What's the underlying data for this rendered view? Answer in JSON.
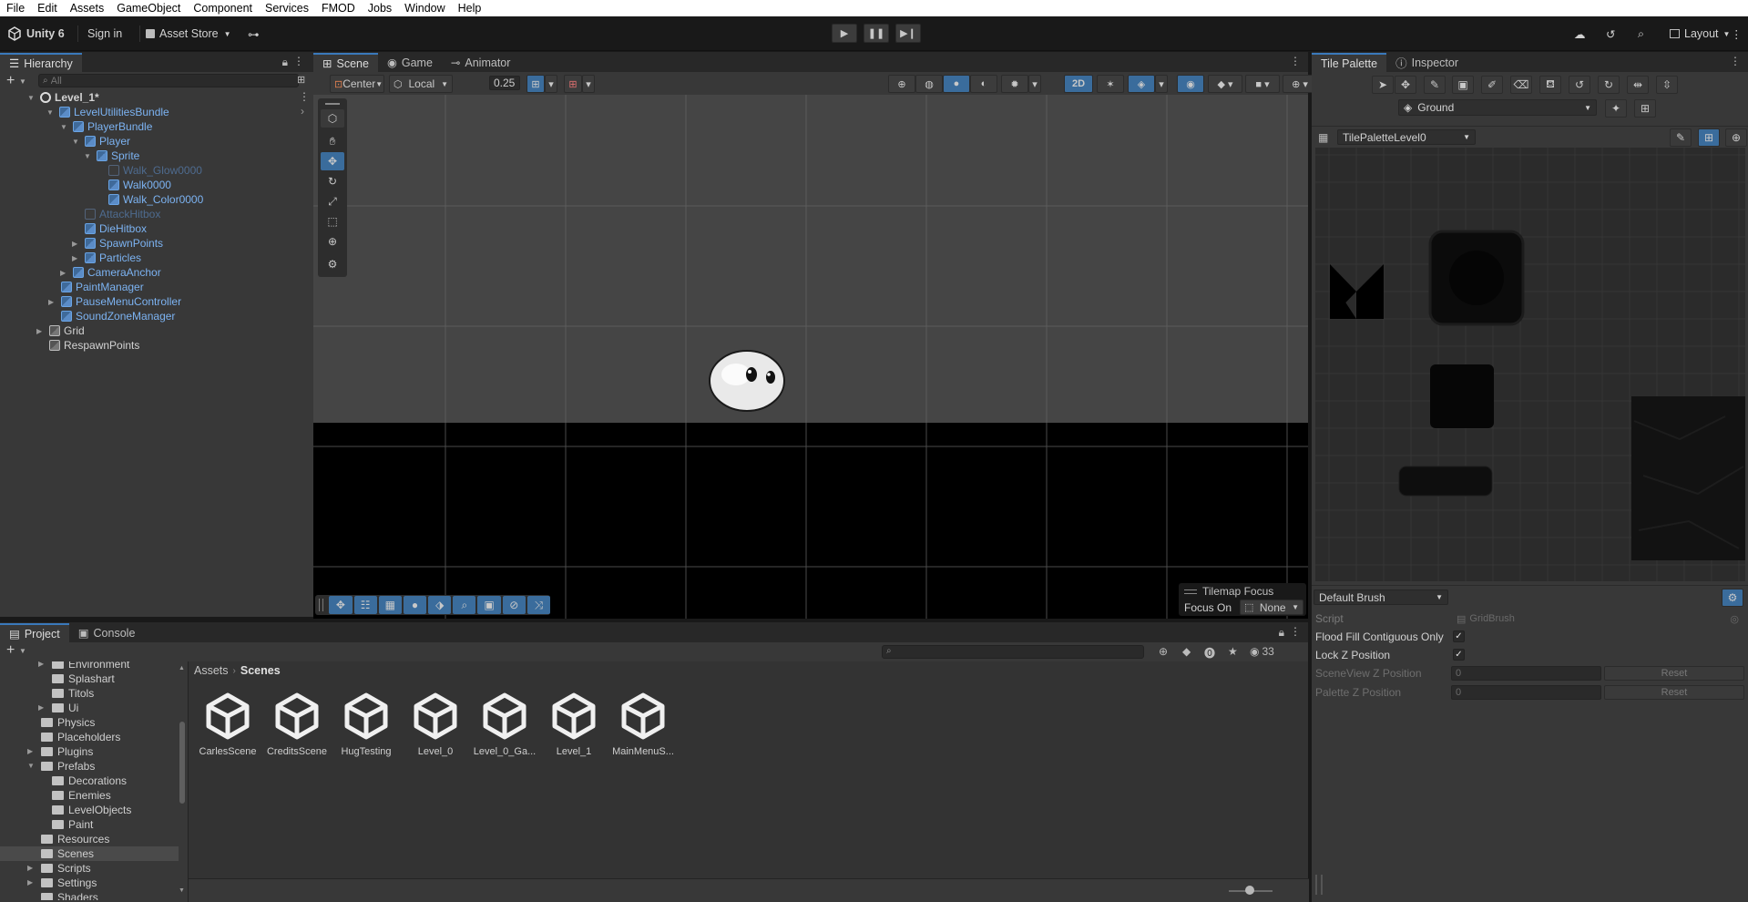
{
  "menu": [
    "File",
    "Edit",
    "Assets",
    "GameObject",
    "Component",
    "Services",
    "FMOD",
    "Jobs",
    "Window",
    "Help"
  ],
  "toolbar": {
    "account": "Unity 6",
    "sign_in": "Sign in",
    "asset_store": "Asset Store",
    "layout": "Layout"
  },
  "hierarchy": {
    "tab": "Hierarchy",
    "search_placeholder": "All",
    "scene": "Level_1*",
    "items": [
      {
        "label": "LevelUtilitiesBundle",
        "depth": 1,
        "style": "blue",
        "expand": "open",
        "icon": "prefab"
      },
      {
        "label": "PlayerBundle",
        "depth": 2,
        "style": "blue",
        "expand": "open",
        "icon": "prefab"
      },
      {
        "label": "Player",
        "depth": 3,
        "style": "blue",
        "expand": "open",
        "icon": "prefab"
      },
      {
        "label": "Sprite",
        "depth": 4,
        "style": "blue",
        "expand": "open",
        "icon": "prefab"
      },
      {
        "label": "Walk_Glow0000",
        "depth": 5,
        "style": "faded",
        "expand": "none",
        "icon": "prefab"
      },
      {
        "label": "Walk0000",
        "depth": 5,
        "style": "blue",
        "expand": "none",
        "icon": "prefab"
      },
      {
        "label": "Walk_Color0000",
        "depth": 5,
        "style": "blue",
        "expand": "none",
        "icon": "prefab"
      },
      {
        "label": "AttackHitbox",
        "depth": 3,
        "style": "faded",
        "expand": "none",
        "icon": "prefab"
      },
      {
        "label": "DieHitbox",
        "depth": 3,
        "style": "blue",
        "expand": "none",
        "icon": "prefab"
      },
      {
        "label": "SpawnPoints",
        "depth": 3,
        "style": "blue",
        "expand": "closed",
        "icon": "prefab"
      },
      {
        "label": "Particles",
        "depth": 3,
        "style": "blue",
        "expand": "closed",
        "icon": "prefab"
      },
      {
        "label": "CameraAnchor",
        "depth": 2,
        "style": "blue",
        "expand": "closed",
        "icon": "prefab"
      },
      {
        "label": "PaintManager",
        "depth": 1,
        "style": "blue",
        "expand": "none",
        "icon": "prefab"
      },
      {
        "label": "PauseMenuController",
        "depth": 1,
        "style": "blue",
        "expand": "closed",
        "icon": "prefab"
      },
      {
        "label": "SoundZoneManager",
        "depth": 1,
        "style": "blue",
        "expand": "none",
        "icon": "prefab"
      },
      {
        "label": "Grid",
        "depth": 0,
        "style": "white",
        "expand": "closed",
        "icon": "object"
      },
      {
        "label": "RespawnPoints",
        "depth": 0,
        "style": "white",
        "expand": "none",
        "icon": "object"
      }
    ]
  },
  "scene_tabs": {
    "scene": "Scene",
    "game": "Game",
    "animator": "Animator"
  },
  "scene_toolbar": {
    "pivot": "Center",
    "space": "Local",
    "snap": "0.25",
    "mode_2d": "2D"
  },
  "tilemap_focus": {
    "title": "Tilemap Focus",
    "label": "Focus On",
    "value": "None"
  },
  "project": {
    "tab": "Project",
    "console_tab": "Console",
    "breadcrumb_root": "Assets",
    "breadcrumb_current": "Scenes",
    "hidden_count": "33",
    "tree": [
      {
        "label": "Environment",
        "depth": 2,
        "expand": "closed"
      },
      {
        "label": "Splashart",
        "depth": 2,
        "expand": "none"
      },
      {
        "label": "Titols",
        "depth": 2,
        "expand": "none"
      },
      {
        "label": "Ui",
        "depth": 2,
        "expand": "closed"
      },
      {
        "label": "Physics",
        "depth": 1,
        "expand": "none"
      },
      {
        "label": "Placeholders",
        "depth": 1,
        "expand": "none"
      },
      {
        "label": "Plugins",
        "depth": 1,
        "expand": "closed"
      },
      {
        "label": "Prefabs",
        "depth": 1,
        "expand": "open"
      },
      {
        "label": "Decorations",
        "depth": 2,
        "expand": "none"
      },
      {
        "label": "Enemies",
        "depth": 2,
        "expand": "none"
      },
      {
        "label": "LevelObjects",
        "depth": 2,
        "expand": "none"
      },
      {
        "label": "Paint",
        "depth": 2,
        "expand": "none"
      },
      {
        "label": "Resources",
        "depth": 1,
        "expand": "none"
      },
      {
        "label": "Scenes",
        "depth": 1,
        "expand": "none"
      },
      {
        "label": "Scripts",
        "depth": 1,
        "expand": "closed"
      },
      {
        "label": "Settings",
        "depth": 1,
        "expand": "closed"
      },
      {
        "label": "Shaders",
        "depth": 1,
        "expand": "none"
      }
    ],
    "selected_folder": "Scenes",
    "assets": [
      "CarlesScene",
      "CreditsScene",
      "HugTesting",
      "Level_0",
      "Level_0_Ga...",
      "Level_1",
      "MainMenuS..."
    ]
  },
  "tile_palette": {
    "tab": "Tile Palette",
    "inspector_tab": "Inspector",
    "layer": "Ground",
    "palette": "TilePaletteLevel0",
    "brush": "Default Brush",
    "fields": {
      "script_label": "Script",
      "script_value": "GridBrush",
      "flood_label": "Flood Fill Contiguous Only",
      "lockz_label": "Lock Z Position",
      "scenez_label": "SceneView Z Position",
      "scenez_value": "0",
      "palettez_label": "Palette Z Position",
      "palettez_value": "0",
      "reset": "Reset"
    }
  },
  "colors": {
    "accent": "#3a79bb",
    "prefab_text": "#7cb3f2",
    "panel": "#383838",
    "background": "#191919"
  }
}
